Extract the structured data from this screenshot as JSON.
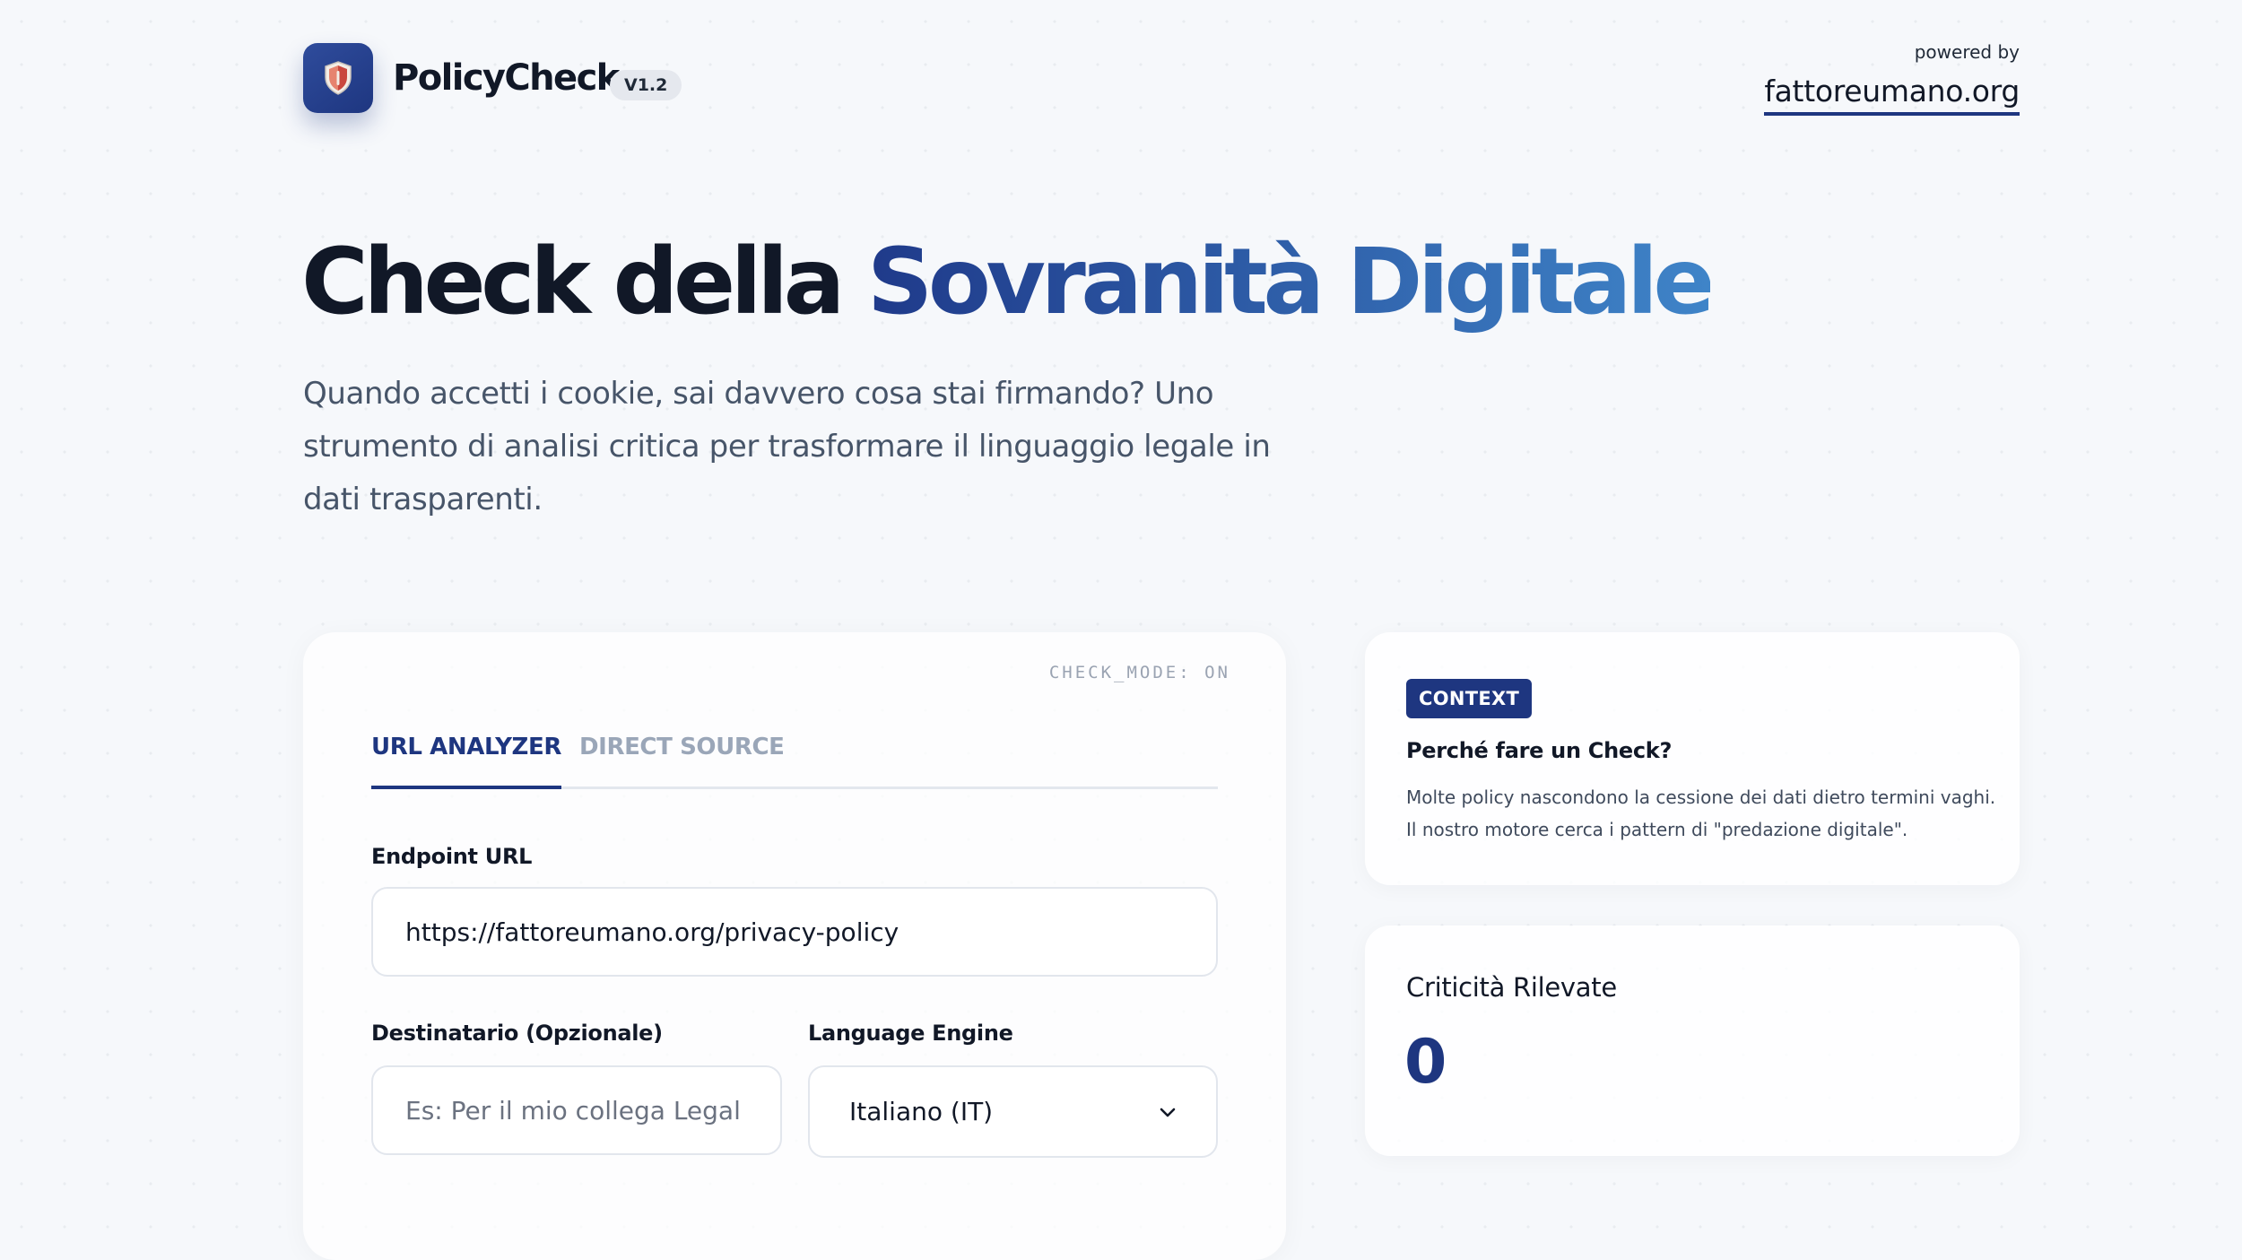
{
  "header": {
    "brand_name": "PolicyCheck",
    "version": "V1.2",
    "powered_by_label": "powered by",
    "powered_by_link": "fattoreumano.org",
    "logo_icon": "shield-icon"
  },
  "hero": {
    "title_plain": "Check della",
    "title_accent": "Sovranità Digitale",
    "subtitle": "Quando accetti i cookie, sai davvero cosa stai firmando? Uno strumento di analisi critica per trasformare il linguaggio legale in dati trasparenti."
  },
  "form": {
    "mode_indicator": "CHECK_MODE: ON",
    "tabs": [
      {
        "label": "URL ANALYZER",
        "active": true
      },
      {
        "label": "DIRECT SOURCE",
        "active": false
      }
    ],
    "endpoint": {
      "label": "Endpoint URL",
      "value": "https://fattoreumano.org/privacy-policy"
    },
    "recipient": {
      "label": "Destinatario (Opzionale)",
      "value": "",
      "placeholder": "Es: Per il mio collega Legal"
    },
    "language": {
      "label": "Language Engine",
      "selected": "Italiano (IT)"
    }
  },
  "context_card": {
    "badge": "CONTEXT",
    "title": "Perché fare un Check?",
    "text": "Molte policy nascondono la cessione dei dati dietro termini vaghi. Il nostro motore cerca i pattern di \"predazione digitale\"."
  },
  "issues_card": {
    "label": "Criticità Rilevate",
    "count": "0"
  },
  "colors": {
    "brand": "#1e3680",
    "accent_gradient_end": "#3f84c8",
    "background": "#f6f8fb",
    "muted_text": "#475569"
  }
}
